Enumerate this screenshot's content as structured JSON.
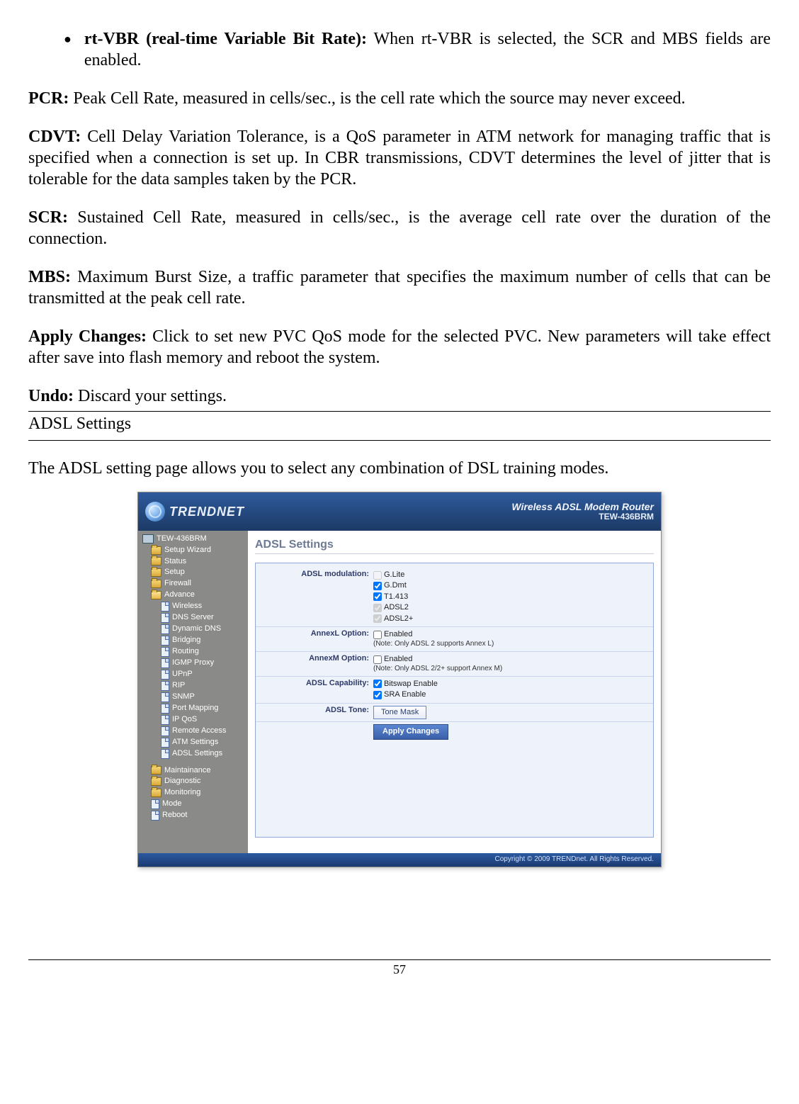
{
  "bullet": {
    "term": "rt-VBR (real-time Variable Bit Rate):",
    "desc": " When rt-VBR is selected, the SCR and MBS fields are enabled."
  },
  "pcr": {
    "term": "PCR:",
    "desc": " Peak Cell Rate, measured in cells/sec., is the cell rate which the source may never exceed."
  },
  "cdvt": {
    "term": "CDVT:",
    "desc": " Cell Delay Variation Tolerance, is a QoS parameter in ATM network for managing traffic that is specified when a connection is set up. In CBR transmissions, CDVT determines the level of jitter that is tolerable for the data samples taken by the PCR."
  },
  "scr": {
    "term": "SCR:",
    "desc": " Sustained Cell Rate, measured in cells/sec., is the average cell rate over the duration of the connection."
  },
  "mbs": {
    "term": "MBS:",
    "desc": " Maximum Burst Size, a traffic parameter that specifies the maximum number of cells that can be transmitted at the peak cell rate."
  },
  "apply": {
    "term": "Apply Changes:",
    "desc": " Click to set new PVC QoS mode for the selected PVC. New parameters will take effect after save into flash memory and reboot the system."
  },
  "undo": {
    "term": "Undo:",
    "desc": " Discard your settings."
  },
  "section_title": "ADSL Settings",
  "section_intro": "The ADSL setting page allows you to select any combination of DSL training modes.",
  "app": {
    "brand": "TRENDNET",
    "tagline": "Wireless ADSL Modem Router",
    "model": "TEW-436BRM",
    "nav": {
      "root": "TEW-436BRM",
      "items": [
        "Setup Wizard",
        "Status",
        "Setup",
        "Firewall",
        "Advance"
      ],
      "advance_children": [
        "Wireless",
        "DNS Server",
        "Dynamic DNS",
        "Bridging",
        "Routing",
        "IGMP Proxy",
        "UPnP",
        "RIP",
        "SNMP",
        "Port Mapping",
        "IP QoS",
        "Remote Access",
        "ATM Settings",
        "ADSL Settings"
      ],
      "after": [
        "Maintainance",
        "Diagnostic",
        "Monitoring",
        "Mode",
        "Reboot"
      ]
    },
    "content": {
      "title": "ADSL Settings",
      "modulation_label": "ADSL modulation:",
      "modulations": [
        {
          "label": "G.Lite",
          "checked": false,
          "disabled": true
        },
        {
          "label": "G.Dmt",
          "checked": true,
          "disabled": false
        },
        {
          "label": "T1.413",
          "checked": true,
          "disabled": false
        },
        {
          "label": "ADSL2",
          "checked": true,
          "disabled": true
        },
        {
          "label": "ADSL2+",
          "checked": true,
          "disabled": true
        }
      ],
      "annexl_label": "AnnexL Option:",
      "annexl_option": "Enabled",
      "annexl_note": "(Note: Only ADSL 2 supports Annex L)",
      "annexm_label": "AnnexM Option:",
      "annexm_option": "Enabled",
      "annexm_note": "(Note: Only ADSL 2/2+ support Annex M)",
      "capability_label": "ADSL Capability:",
      "capability": [
        {
          "label": "Bitswap Enable",
          "checked": true
        },
        {
          "label": "SRA Enable",
          "checked": true
        }
      ],
      "tone_label": "ADSL Tone:",
      "tone_button": "Tone Mask",
      "apply_button": "Apply Changes"
    },
    "footer": "Copyright © 2009 TRENDnet. All Rights Reserved."
  },
  "page_number": "57"
}
